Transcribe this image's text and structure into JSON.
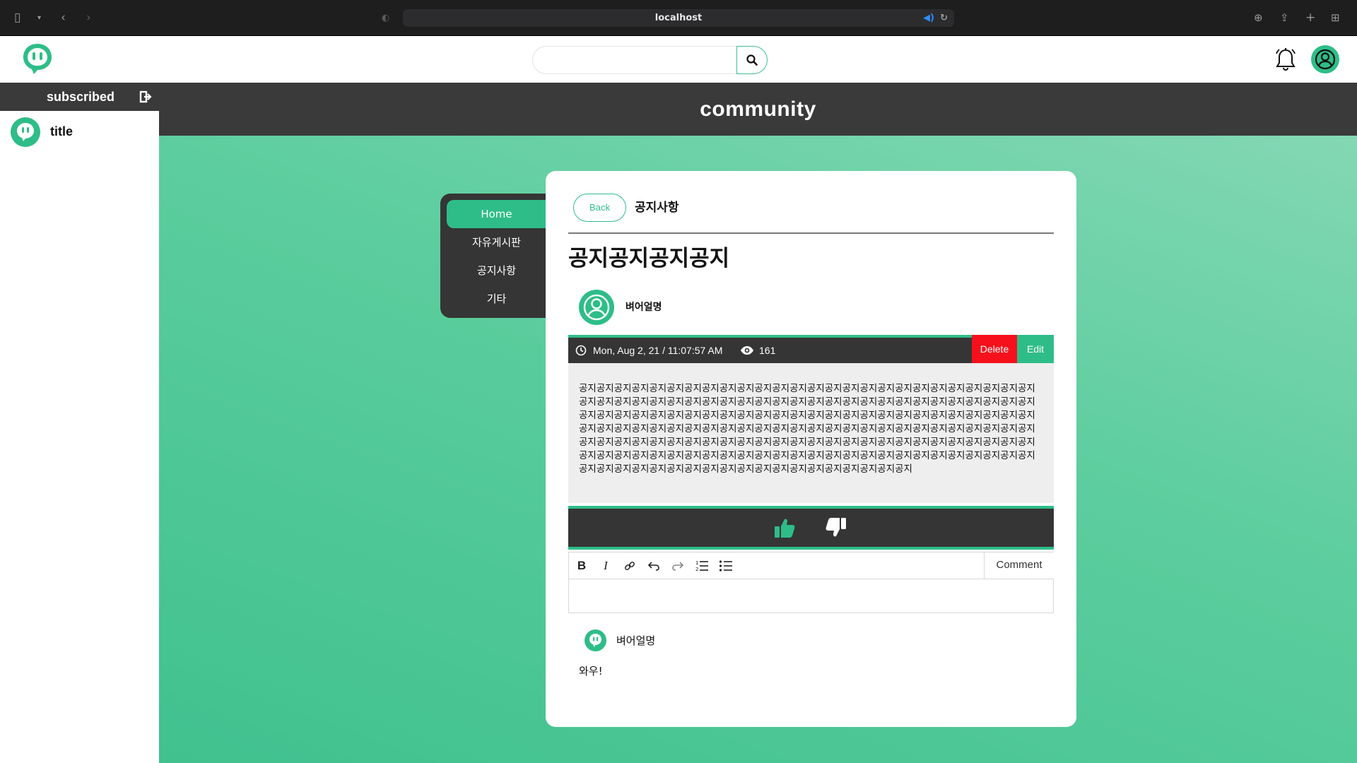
{
  "browser": {
    "url": "localhost"
  },
  "header": {
    "search": {
      "placeholder": "",
      "value": ""
    }
  },
  "sidebar": {
    "heading": "subscribed",
    "items": [
      {
        "label": "title"
      }
    ]
  },
  "banner": {
    "title": "community"
  },
  "board_nav": {
    "items": [
      {
        "label": "Home",
        "active": true
      },
      {
        "label": "자유게시판",
        "active": false
      },
      {
        "label": "공지사항",
        "active": false
      },
      {
        "label": "기타",
        "active": false
      }
    ]
  },
  "post": {
    "back_label": "Back",
    "board_name": "공지사항",
    "title": "공지공지공지공지",
    "author": "벼어얼명",
    "date": "Mon, Aug 2, 21 / 11:07:57 AM",
    "views": "161",
    "delete_label": "Delete",
    "edit_label": "Edit",
    "body": "공지공지공지공지공지공지공지공지공지공지공지공지공지공지공지공지공지공지공지공지공지공지공지공지공지공지공지공지공지공지공지공지공지공지공지공지공지공지공지공지공지공지공지공지공지공지공지공지공지공지공지공지공지공지공지공지공지공지공지공지공지공지공지공지공지공지공지공지공지공지공지공지공지공지공지공지공지공지공지공지공지공지공지공지공지공지공지공지공지공지공지공지공지공지공지공지공지공지공지공지공지공지공지공지공지공지공지공지공지공지공지공지공지공지공지공지공지공지공지공지공지공지공지공지공지공지공지공지공지공지공지공지공지공지공지공지공지공지공지공지공지공지공지공지공지공지공지공지공지공지공지공지공지공지공지공지공지공지공지공지공지공지공지공지공지공지공지공지공지공지공지공지공지공지공지"
  },
  "editor": {
    "comment_label": "Comment",
    "toolbar": [
      "bold-icon",
      "italic-icon",
      "link-icon",
      "undo-icon",
      "redo-icon",
      "ordered-list-icon",
      "bullet-list-icon"
    ]
  },
  "comments": [
    {
      "author": "벼어얼명",
      "text": "와우!"
    }
  ],
  "colors": {
    "accent": "#2ebd88",
    "dark": "#353535",
    "danger": "#f5101c"
  }
}
